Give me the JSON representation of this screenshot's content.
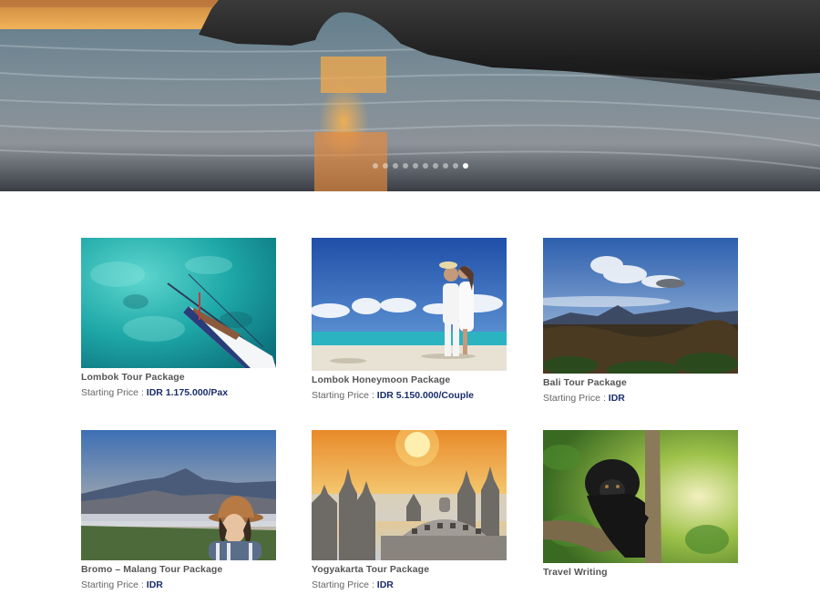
{
  "hero": {
    "image": "sea-arch-sunset-photo",
    "slides": 10,
    "active_slide": 10
  },
  "packages": [
    {
      "title": "Lombok Tour Package",
      "price_label": "Starting Price :",
      "price": "IDR 1.175.000/Pax",
      "image": "turquoise-sea-boat-photo"
    },
    {
      "title": "Lombok Honeymoon Package",
      "price_label": "Starting Price :",
      "price": "IDR 5.150.000/Couple",
      "image": "beach-couple-photo"
    },
    {
      "title": "Bali Tour Package",
      "price_label": "Starting Price :",
      "price": "IDR",
      "image": "volcano-landscape-photo"
    },
    {
      "title": "Bromo – Malang Tour Package",
      "price_label": "Starting Price :",
      "price": "IDR",
      "image": "bromo-traveler-photo"
    },
    {
      "title": "Yogyakarta Tour Package",
      "price_label": "Starting Price :",
      "price": "IDR",
      "image": "borobudur-temple-photo"
    },
    {
      "title": "Travel Writing",
      "image": "black-monkey-tree-photo"
    }
  ],
  "colors": {
    "price_accent": "#1a2d6b",
    "title": "#555555"
  }
}
